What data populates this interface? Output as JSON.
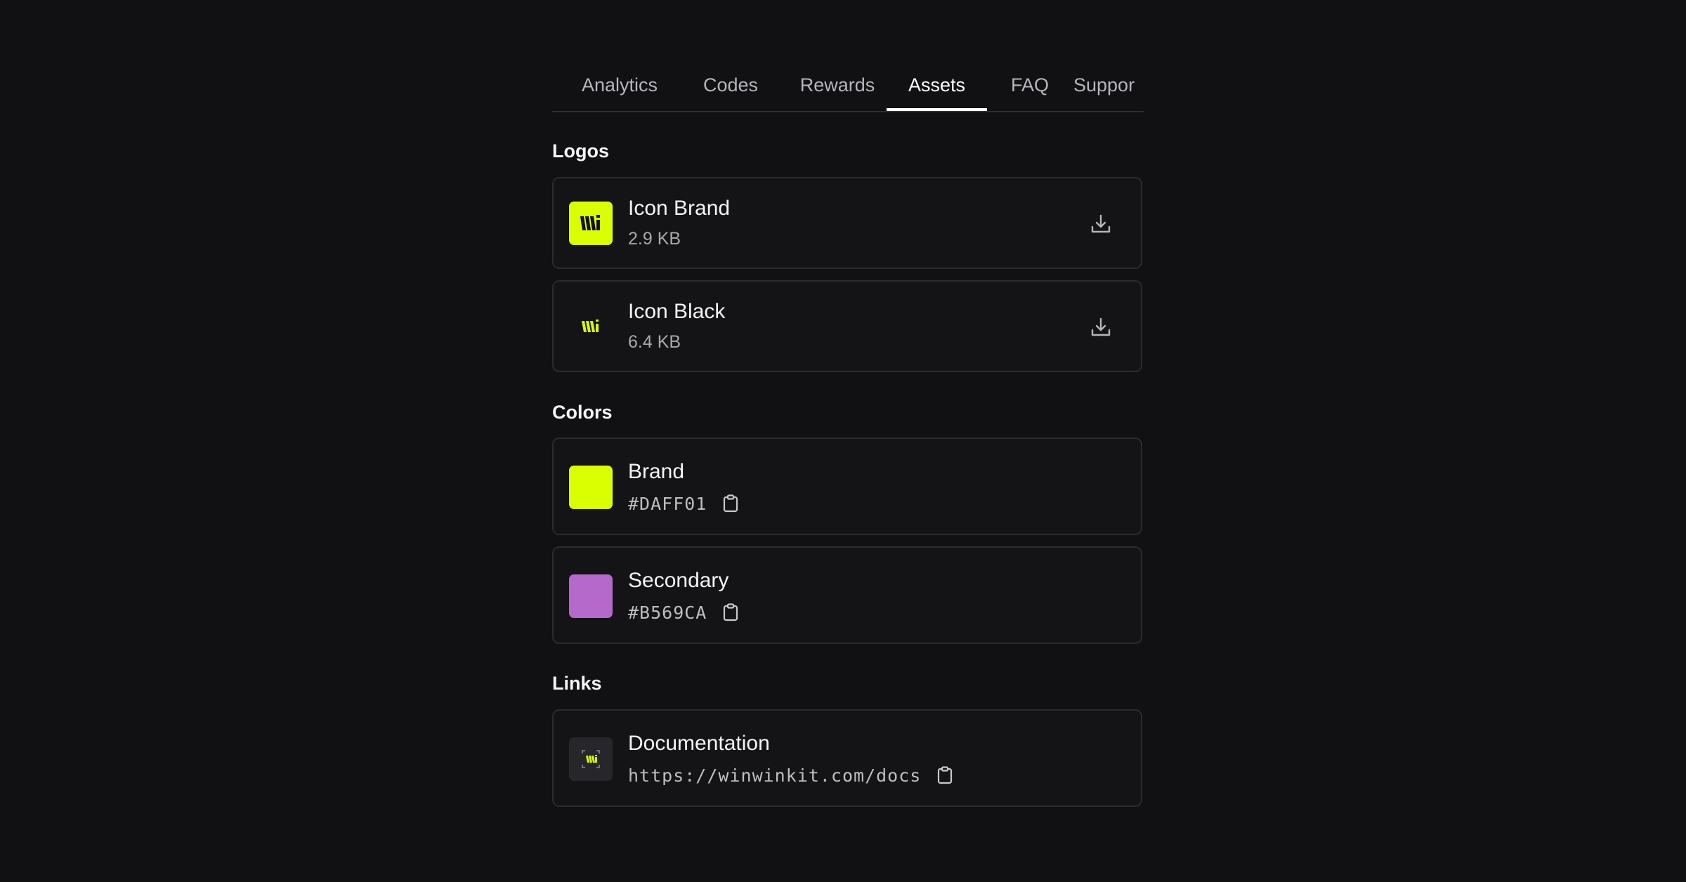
{
  "tabs": [
    {
      "label": "Analytics"
    },
    {
      "label": "Codes"
    },
    {
      "label": "Rewards"
    },
    {
      "label": "Assets",
      "active": true
    },
    {
      "label": "FAQ"
    },
    {
      "label": "Suppor"
    }
  ],
  "sections": {
    "logos": {
      "title": "Logos",
      "items": [
        {
          "name": "Icon Brand",
          "size": "2.9 KB",
          "icon": "download-icon"
        },
        {
          "name": "Icon Black",
          "size": "6.4 KB",
          "icon": "download-icon"
        }
      ]
    },
    "colors": {
      "title": "Colors",
      "items": [
        {
          "name": "Brand",
          "hex": "#DAFF01",
          "swatch": "#DAFF01"
        },
        {
          "name": "Secondary",
          "hex": "#B569CA",
          "swatch": "#B569CA"
        }
      ]
    },
    "links": {
      "title": "Links",
      "items": [
        {
          "name": "Documentation",
          "url": "https://winwinkit.com/docs"
        }
      ]
    }
  },
  "colors": {
    "background": "#111114",
    "card_border": "#2a2a2f",
    "brand": "#DAFF01",
    "secondary": "#B569CA"
  }
}
